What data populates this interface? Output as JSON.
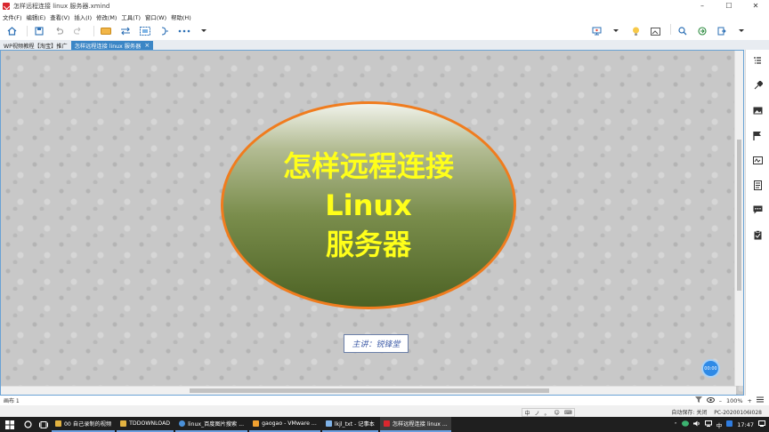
{
  "window": {
    "title": "怎样远程连接 linux 服务器.xmind",
    "minimize": "–",
    "maximize": "☐",
    "close": "✕"
  },
  "menu": [
    "文件(F)",
    "编辑(E)",
    "查看(V)",
    "插入(I)",
    "修改(M)",
    "工具(T)",
    "窗口(W)",
    "帮助(H)"
  ],
  "tabs": [
    {
      "label": "WP视频教程【淘宝】推广",
      "active": false
    },
    {
      "label": "怎样远程连接 linux 服务器",
      "active": true,
      "close": "×"
    }
  ],
  "mindmap": {
    "central_topic": [
      "怎样远程连接",
      "Linux",
      "服务器"
    ],
    "subtopic": "主讲：锐锋堂"
  },
  "timer": "00:00",
  "statusbar": {
    "sheet": "画布 1",
    "zoom": "100%",
    "zoom_minus": "–",
    "zoom_plus": "+",
    "autosave": "自动保存: 关闭",
    "computer": "PC-20200106I028"
  },
  "ime": [
    "中",
    "ノ",
    "。",
    "☺",
    "⌨"
  ],
  "taskbar": {
    "items": [
      {
        "label": "00 自己录制的视频",
        "color": "#e3b341"
      },
      {
        "label": "TDDOWNLOAD",
        "color": "#e3b341"
      },
      {
        "label": "linux_百度图片搜索 ...",
        "color": "#4a90d9"
      },
      {
        "label": "gaogao - VMware ...",
        "color": "#f0a030"
      },
      {
        "label": "lkjl_txt - 记事本",
        "color": "#7fb3e8"
      },
      {
        "label": "怎样远程连接 linux ...",
        "color": "#d9272e"
      }
    ],
    "tray_lang": "中",
    "clock": "17:47"
  },
  "colors": {
    "accent": "#3b86c6",
    "topic_border": "#f07c1e",
    "topic_text": "#ffff1a"
  }
}
